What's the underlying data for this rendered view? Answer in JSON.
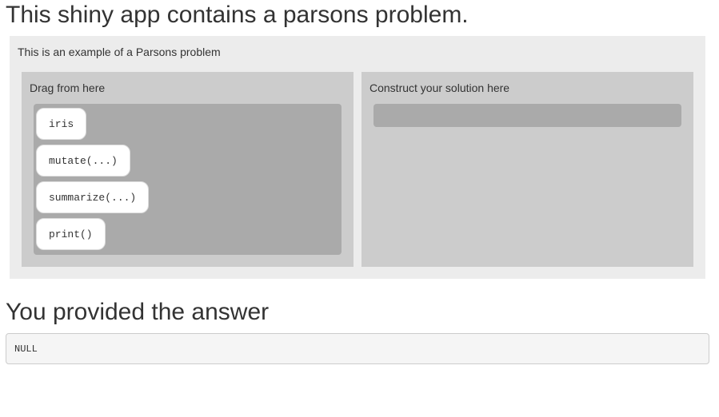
{
  "page": {
    "title": "This shiny app contains a parsons problem."
  },
  "parsons": {
    "description": "This is an example of a Parsons problem",
    "source_panel": {
      "header": "Drag from here",
      "items": [
        {
          "label": "iris"
        },
        {
          "label": "mutate(...)"
        },
        {
          "label": "summarize(...)"
        },
        {
          "label": "print()"
        }
      ]
    },
    "target_panel": {
      "header": "Construct your solution here",
      "items": []
    }
  },
  "answer": {
    "title": "You provided the answer",
    "value": "NULL"
  }
}
